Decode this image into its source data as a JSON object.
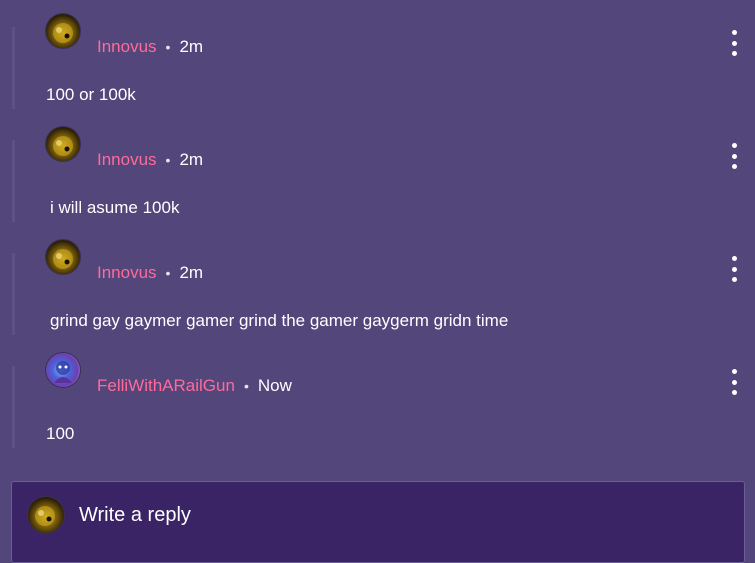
{
  "comments": [
    {
      "username": "Innovus",
      "separator": "•",
      "time": "2m",
      "text": "100 or 100k",
      "avatar": "gold-orb-avatar"
    },
    {
      "username": "Innovus",
      "separator": "•",
      "time": "2m",
      "text": "i will asume 100k",
      "avatar": "gold-orb-avatar"
    },
    {
      "username": "Innovus",
      "separator": "•",
      "time": "2m",
      "text": "grind gay gaymer gamer grind the gamer gaygerm gridn time",
      "avatar": "gold-orb-avatar"
    },
    {
      "username": "FelliWithARailGun",
      "separator": "•",
      "time": "Now",
      "text": "100",
      "avatar": "blue-character-avatar"
    }
  ],
  "reply": {
    "placeholder": "Write a reply",
    "avatar": "gold-orb-avatar"
  },
  "colors": {
    "background": "#52467a",
    "username": "#ff6a9a",
    "reply_box": "#3a2466"
  },
  "icons": {
    "menu": "more-vertical-icon"
  }
}
